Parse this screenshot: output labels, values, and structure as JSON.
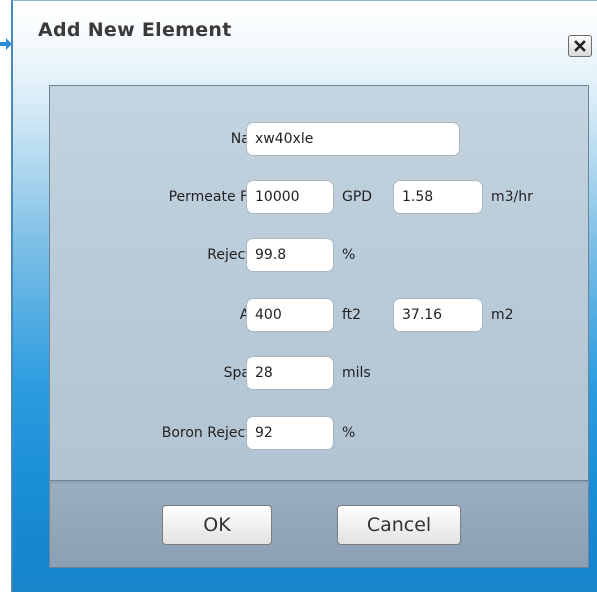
{
  "window": {
    "title": "Add New Element",
    "close_icon": "close-icon"
  },
  "colors": {
    "accent": "#1a8fd7",
    "panel": "#bccdda",
    "button_panel": "#94a9bc"
  },
  "form": {
    "name": {
      "label": "Name",
      "value": "xw40xle"
    },
    "permeate_flow": {
      "label": "Permeate Flow",
      "value": "10000",
      "unit": "GPD",
      "alt_value": "1.58",
      "alt_unit": "m3/hr"
    },
    "rejection": {
      "label": "Rejection",
      "value": "99.8",
      "unit": "%"
    },
    "area": {
      "label": "Area",
      "value": "400",
      "unit": "ft2",
      "alt_value": "37.16",
      "alt_unit": "m2"
    },
    "spacer": {
      "label": "Spacer",
      "value": "28",
      "unit": "mils"
    },
    "boron_rejection": {
      "label": "Boron Rejection",
      "value": "92",
      "unit": "%"
    }
  },
  "buttons": {
    "ok": "OK",
    "cancel": "Cancel"
  }
}
